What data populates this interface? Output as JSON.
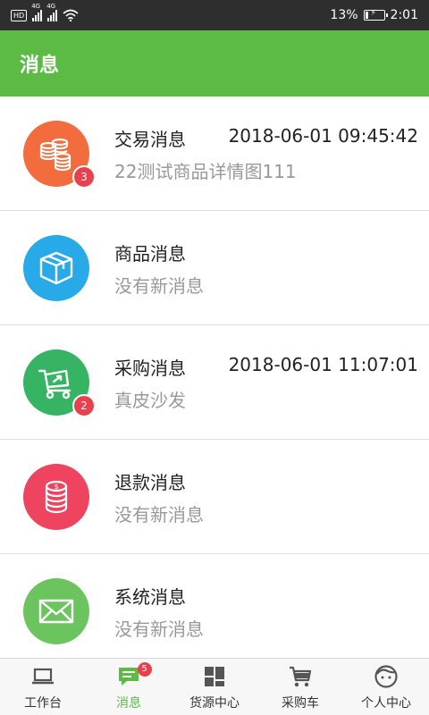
{
  "status_bar": {
    "hd": "HD",
    "net1": "4G",
    "net2": "4G",
    "battery_percent": "13%",
    "battery_level": 0.13,
    "time": "2:01"
  },
  "header": {
    "title": "消息",
    "color": "#5cbb45"
  },
  "messages": [
    {
      "title": "交易消息",
      "time": "2018-06-01 09:45:42",
      "subtitle": "22测试商品详情图111",
      "badge": "3",
      "icon": "coins-icon",
      "color": "#f26c3d"
    },
    {
      "title": "商品消息",
      "time": "",
      "subtitle": "没有新消息",
      "badge": "",
      "icon": "box-icon",
      "color": "#29aae8"
    },
    {
      "title": "采购消息",
      "time": "2018-06-01 11:07:01",
      "subtitle": "真皮沙发",
      "badge": "2",
      "icon": "cart-icon",
      "color": "#37b463"
    },
    {
      "title": "退款消息",
      "time": "",
      "subtitle": "没有新消息",
      "badge": "",
      "icon": "refund-coins-icon",
      "color": "#ee4460"
    },
    {
      "title": "系统消息",
      "time": "",
      "subtitle": "没有新消息",
      "badge": "",
      "icon": "envelope-icon",
      "color": "#6cc45e"
    }
  ],
  "tabs": [
    {
      "label": "工作台",
      "icon": "laptop-icon",
      "active": false,
      "badge": ""
    },
    {
      "label": "消息",
      "icon": "message-icon",
      "active": true,
      "badge": "5"
    },
    {
      "label": "货源中心",
      "icon": "grid-icon",
      "active": false,
      "badge": ""
    },
    {
      "label": "采购车",
      "icon": "cart-icon",
      "active": false,
      "badge": ""
    },
    {
      "label": "个人中心",
      "icon": "face-icon",
      "active": false,
      "badge": ""
    }
  ]
}
